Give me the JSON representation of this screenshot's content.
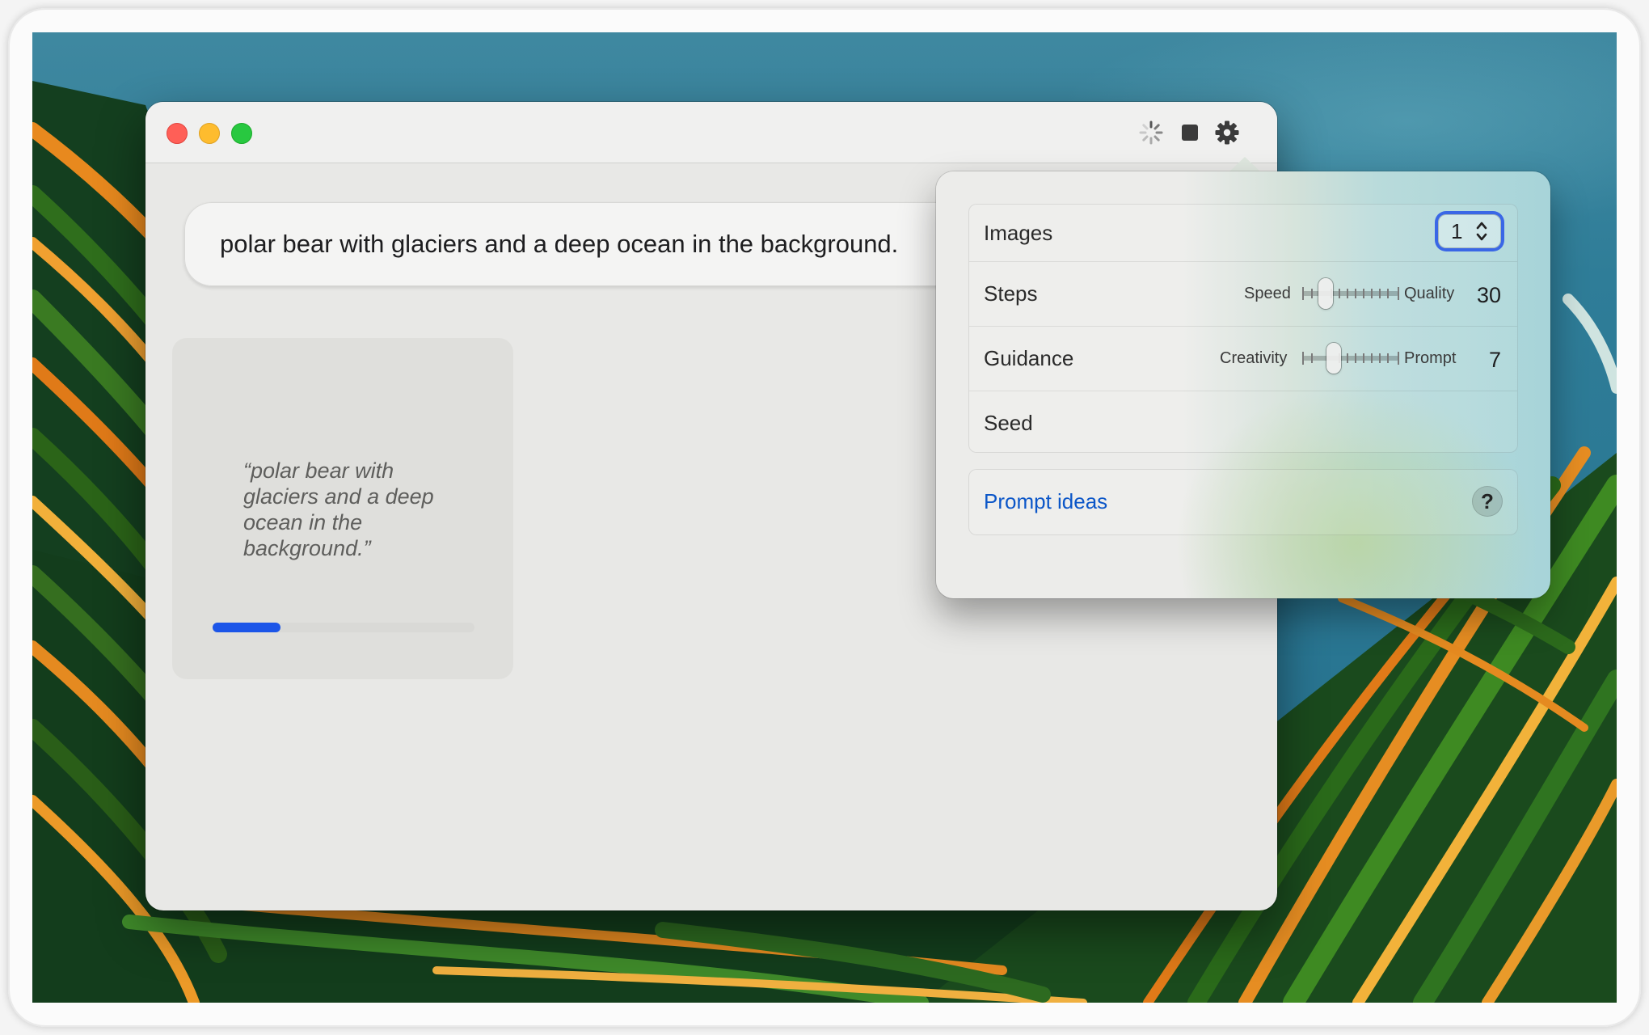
{
  "window": {
    "prompt_text": "polar bear with glaciers and a deep ocean in the background."
  },
  "toolbar": {
    "icons": [
      "progress-spinner-icon",
      "stop-icon",
      "gear-icon"
    ]
  },
  "generation_card": {
    "caption": "“polar bear with glaciers and a deep ocean in the background.”",
    "progress": 0.26
  },
  "settings": {
    "images": {
      "label": "Images",
      "value": "1"
    },
    "steps": {
      "label": "Steps",
      "min_label": "Speed",
      "max_label": "Quality",
      "value": "30"
    },
    "guidance": {
      "label": "Guidance",
      "min_label": "Creativity",
      "max_label": "Prompt",
      "value": "7"
    },
    "seed": {
      "label": "Seed",
      "value": ""
    },
    "prompt_ideas": {
      "label": "Prompt ideas",
      "help": "?"
    }
  },
  "colors": {
    "accent": "#1c55e8",
    "link": "#0b56c8",
    "traffic_red": "#ff5f57",
    "traffic_yellow": "#febc2e",
    "traffic_green": "#28c840"
  }
}
